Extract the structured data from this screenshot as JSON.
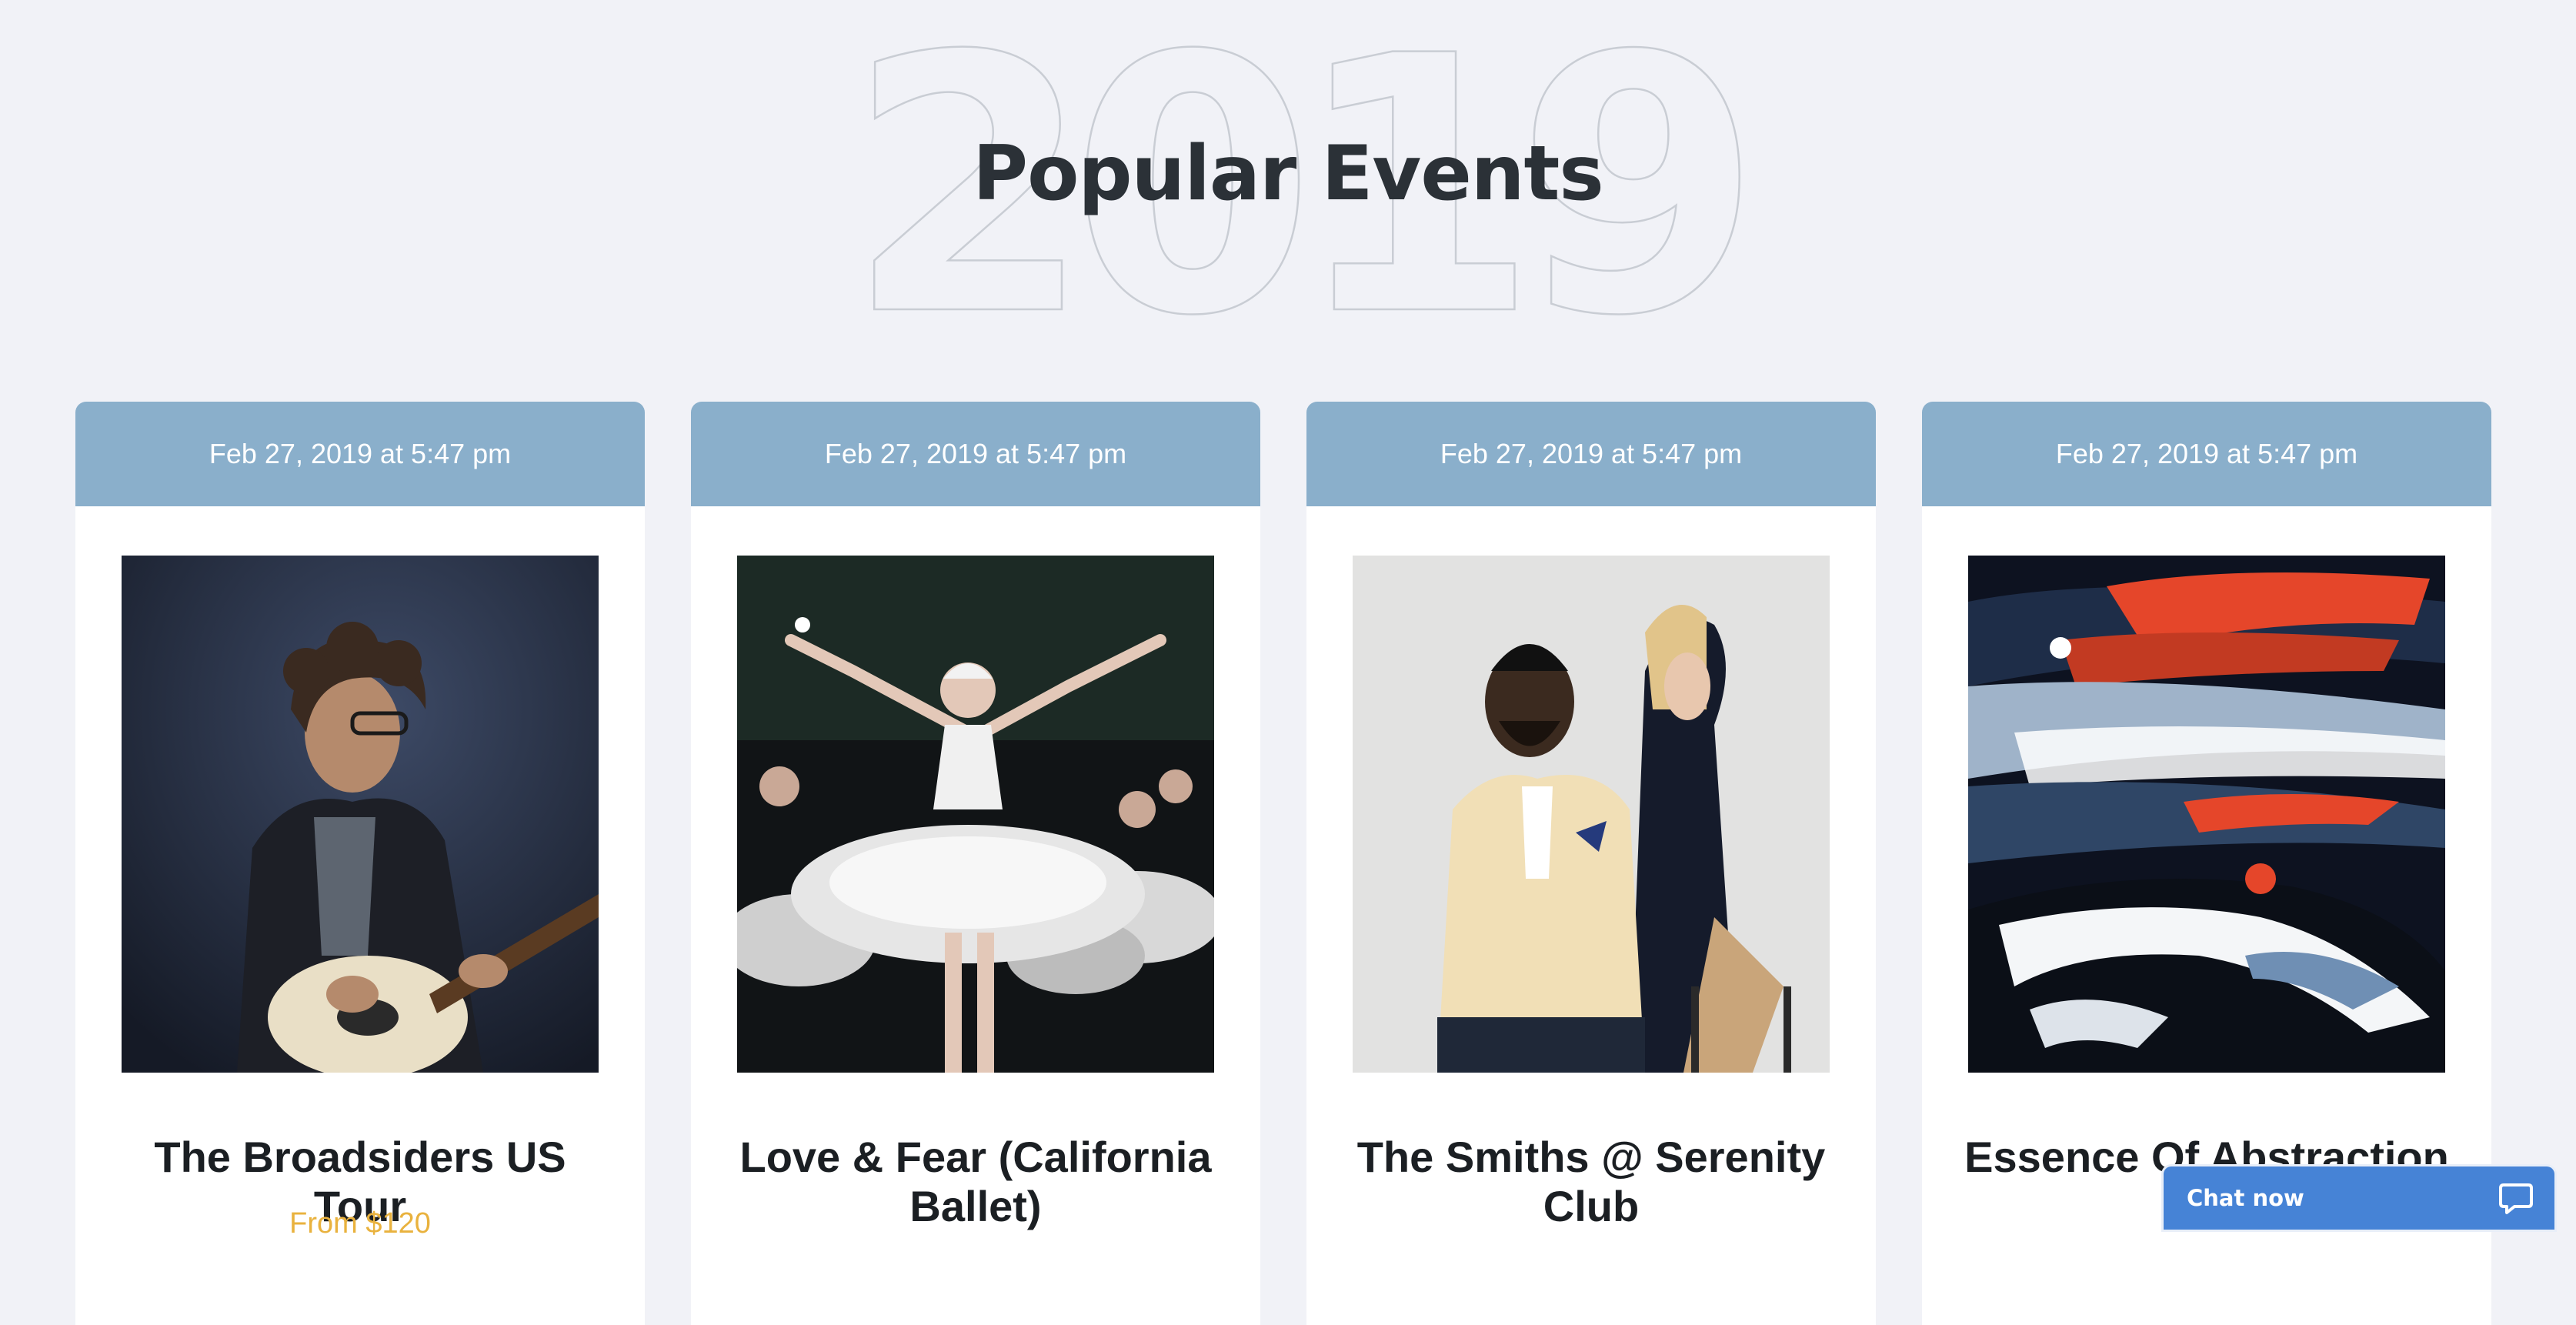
{
  "hero": {
    "background_year": "2019",
    "title": "Popular Events"
  },
  "events": [
    {
      "date": "Feb 27, 2019 at 5:47 pm",
      "title": "The Broadsiders US Tour",
      "price": "From $120",
      "image": "guitarist-photo"
    },
    {
      "date": "Feb 27, 2019 at 5:47 pm",
      "title": "Love & Fear (California Ballet)",
      "price": "",
      "image": "ballet-photo"
    },
    {
      "date": "Feb 27, 2019 at 5:47 pm",
      "title": "The Smiths @ Serenity Club",
      "price": "",
      "image": "couple-photo"
    },
    {
      "date": "Feb 27, 2019 at 5:47 pm",
      "title": "Essence Of Abstraction",
      "price": "",
      "image": "abstract-painting"
    }
  ],
  "chat": {
    "label": "Chat now",
    "icon": "chat-bubble-icon"
  },
  "colors": {
    "page_background": "#f1f2f7",
    "date_bar": "#8aafcb",
    "price_text": "#e9b23e",
    "chat_button": "#4683d6",
    "title_text": "#2b3137"
  }
}
